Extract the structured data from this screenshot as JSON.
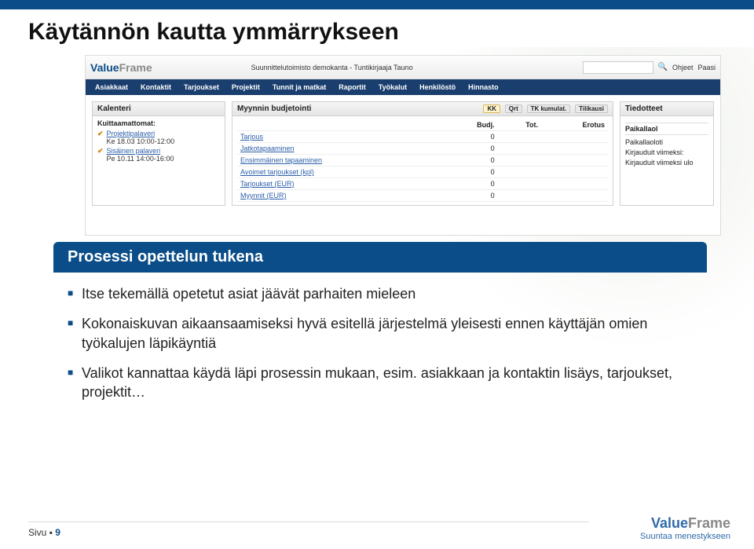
{
  "slide": {
    "title": "Käytännön kautta ymmärrykseen",
    "content_heading": "Prosessi opettelun tukena",
    "bullets": [
      "Itse tekemällä opetetut asiat jäävät parhaiten mieleen",
      "Kokonaiskuvan aikaansaamiseksi hyvä esitellä järjestelmä yleisesti ennen käyttäjän omien työkalujen läpikäyntiä",
      "Valikot kannattaa käydä läpi prosessin mukaan, esim. asiakkaan ja kontaktin lisäys, tarjoukset, projektit…"
    ]
  },
  "app": {
    "logo_value": "Value",
    "logo_frame": "Frame",
    "subtitle": "Suunnittelutoimisto demokanta - Tuntikirjaaja Tauno",
    "search_placeholder": "",
    "header_links": [
      "Ohjeet",
      "Paasi"
    ],
    "nav": [
      "Asiakkaat",
      "Kontaktit",
      "Tarjoukset",
      "Projektit",
      "Tunnit ja matkat",
      "Raportit",
      "Työkalut",
      "Henkilöstö",
      "Hinnasto"
    ],
    "calendar": {
      "title": "Kalenteri",
      "section": "Kuittaamattomat:",
      "items": [
        {
          "title": "Projektipalaveri",
          "sub": "Ke 18.03 10:00-12:00"
        },
        {
          "title": "Sisäinen palaveri",
          "sub": "Pe 10.11 14:00-16:00"
        }
      ]
    },
    "budget": {
      "title": "Myynnin budjetointi",
      "tabs": [
        "KK",
        "Qrt",
        "TK kumulat.",
        "Tilikausi"
      ],
      "cols": [
        "Budj.",
        "Tot.",
        "Erotus"
      ],
      "rows": [
        {
          "label": "Tarjous",
          "v": "0"
        },
        {
          "label": "Jatkotapaaminen",
          "v": "0"
        },
        {
          "label": "Ensimmäinen tapaaminen",
          "v": "0"
        },
        {
          "label": "Avoimet tarjoukset (kpl)",
          "v": "0"
        },
        {
          "label": "Tarjoukset (EUR)",
          "v": "0"
        },
        {
          "label": "Myynnit (EUR)",
          "v": "0"
        }
      ]
    },
    "info": {
      "title": "Tiedotteet",
      "section": "Paikallaol",
      "lines": [
        "Paikallaoloti",
        "Kirjauduit viimeksi:",
        "Kirjauduit viimeksi ulo"
      ]
    }
  },
  "footer": {
    "label": "Sivu",
    "page": "9",
    "brand_value": "Value",
    "brand_frame": "Frame",
    "tagline": "Suuntaa menestykseen"
  }
}
